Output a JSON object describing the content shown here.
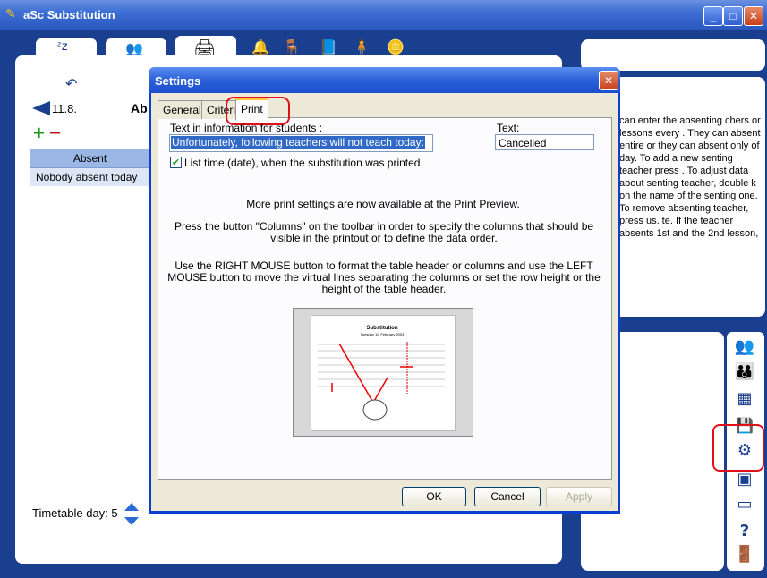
{
  "window": {
    "title": "aSc Substitution",
    "minimize": "_",
    "maximize": "□",
    "close": "✕"
  },
  "left": {
    "date": "11.8.",
    "title_partial": "Ab",
    "add": "+",
    "remove": "−",
    "table_header": "Absent",
    "table_row": "Nobody absent today",
    "timetable_day": "Timetable day: 5"
  },
  "help_text": "can enter the absenting chers or lessons every . They can absent entire or they can absent only of day. To add a new senting teacher press . To adjust data about senting teacher, double k on the name of the senting one. To remove absenting teacher, press us. te. If the teacher absents 1st and the 2nd lesson,",
  "dialog": {
    "title": "Settings",
    "close": "✕",
    "tabs": [
      "General",
      "Criteria",
      "Print"
    ],
    "active_tab": "Print",
    "students_label": "Text in information for students :",
    "students_value": "Unfortunately, following teachers will not teach today:",
    "text_label": "Text:",
    "text_value": "Cancelled",
    "checkbox_label": "List time (date), when the substitution was printed",
    "checkbox_checked": true,
    "info1": "More print settings are now available at the Print Preview.",
    "info2": "Press the button \"Columns\" on the toolbar in order to specify the columns that should be visible in the printout or to define the data order.",
    "info3": "Use the RIGHT MOUSE button to format the table header or columns and use the LEFT MOUSE button to move the virtual lines separating the columns or set the row height or the height of the table header.",
    "preview_title": "Substitution",
    "preview_subtitle": "Tuesday 11. February 2003",
    "buttons": {
      "ok": "OK",
      "cancel": "Cancel",
      "apply": "Apply"
    }
  }
}
